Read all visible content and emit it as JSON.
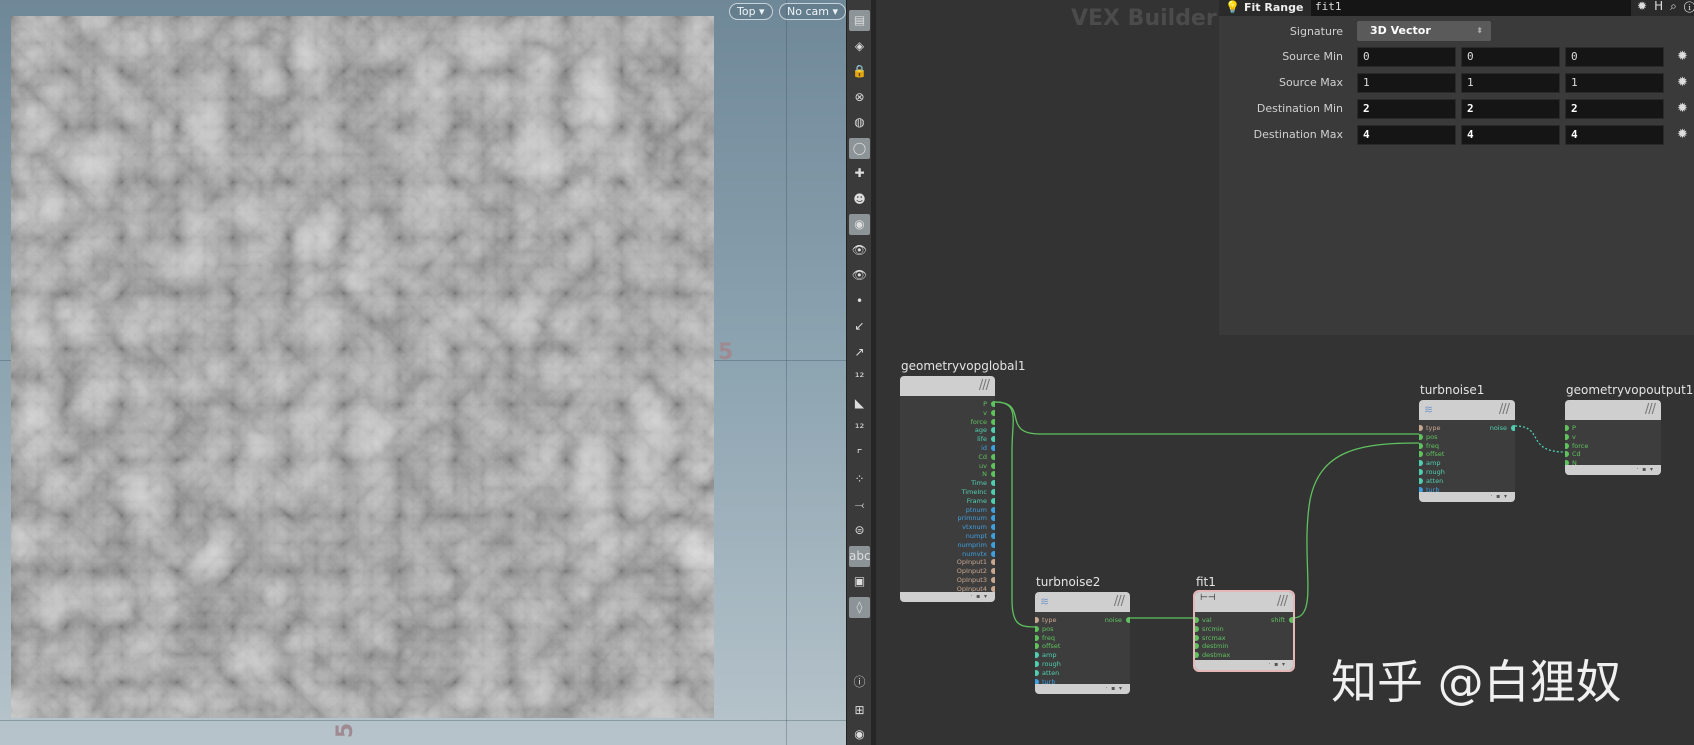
{
  "viewport": {
    "view_menu": "Top ▾",
    "camera_menu": "No cam ▾",
    "axis_labels": [
      "5",
      "5"
    ]
  },
  "toolbar": {
    "icons": [
      "display-options-icon",
      "snapping-icon",
      "lock-icon",
      "ghost-icon",
      "shading-icon",
      "light-icon",
      "add-light-icon",
      "headlight-icon",
      "render-icon",
      "visibility-icon",
      "camera-visibility-icon",
      "point-icon",
      "normal-icon",
      "point-normal-icon",
      "point-number-icon",
      "prim-normal-icon",
      "prim-number-icon",
      "uv-icon",
      "breakpoint-icon",
      "vector-icon",
      "bounding-icon",
      "abc",
      "background-image-icon",
      "pin-icon",
      "info-icon",
      "layout-grid-icon",
      "eye-icon"
    ]
  },
  "network": {
    "title": "VEX Builder",
    "watermark": "知乎 @白狸奴"
  },
  "params": {
    "node_type": "Fit Range",
    "node_name": "fit1",
    "header_icons": [
      "gear-icon",
      "hda-icon",
      "search-icon",
      "info-icon",
      "help-icon"
    ],
    "signature_label": "Signature",
    "signature_value": "3D Vector",
    "rows": [
      {
        "label": "Source Min",
        "values": [
          "0",
          "0",
          "0"
        ]
      },
      {
        "label": "Source Max",
        "values": [
          "1",
          "1",
          "1"
        ]
      },
      {
        "label": "Destination Min",
        "values": [
          "2",
          "2",
          "2"
        ]
      },
      {
        "label": "Destination Max",
        "values": [
          "4",
          "4",
          "4"
        ]
      }
    ]
  },
  "colors": {
    "vector": "#5fc25f",
    "float": "#4fcfb0",
    "int": "#3fa0e0",
    "string": "#c8a890"
  },
  "nodes": [
    {
      "name": "geometryvopglobal1",
      "inputs": [],
      "outputs": [
        [
          "P",
          "vector"
        ],
        [
          "v",
          "vector"
        ],
        [
          "force",
          "vector"
        ],
        [
          "age",
          "float"
        ],
        [
          "life",
          "float"
        ],
        [
          "id",
          "int"
        ],
        [
          "Cd",
          "vector"
        ],
        [
          "uv",
          "vector"
        ],
        [
          "N",
          "vector"
        ],
        [
          "Time",
          "float"
        ],
        [
          "TimeInc",
          "float"
        ],
        [
          "Frame",
          "float"
        ],
        [
          "ptnum",
          "int"
        ],
        [
          "primnum",
          "int"
        ],
        [
          "vtxnum",
          "int"
        ],
        [
          "numpt",
          "int"
        ],
        [
          "numprim",
          "int"
        ],
        [
          "numvtx",
          "int"
        ],
        [
          "OpInput1",
          "string"
        ],
        [
          "OpInput2",
          "string"
        ],
        [
          "OpInput3",
          "string"
        ],
        [
          "OpInput4",
          "string"
        ]
      ]
    },
    {
      "name": "turbnoise2",
      "inputs": [
        [
          "type",
          "string"
        ],
        [
          "pos",
          "vector"
        ],
        [
          "freq",
          "vector"
        ],
        [
          "offset",
          "vector"
        ],
        [
          "amp",
          "float"
        ],
        [
          "rough",
          "float"
        ],
        [
          "atten",
          "float"
        ],
        [
          "turb",
          "int"
        ]
      ],
      "outputs": [
        [
          "noise",
          "vector"
        ]
      ]
    },
    {
      "name": "fit1",
      "inputs": [
        [
          "val",
          "vector"
        ],
        [
          "srcmin",
          "vector"
        ],
        [
          "srcmax",
          "vector"
        ],
        [
          "destmin",
          "vector"
        ],
        [
          "destmax",
          "vector"
        ]
      ],
      "outputs": [
        [
          "shift",
          "vector"
        ]
      ]
    },
    {
      "name": "turbnoise1",
      "inputs": [
        [
          "type",
          "string"
        ],
        [
          "pos",
          "vector"
        ],
        [
          "freq",
          "vector"
        ],
        [
          "offset",
          "vector"
        ],
        [
          "amp",
          "float"
        ],
        [
          "rough",
          "float"
        ],
        [
          "atten",
          "float"
        ],
        [
          "turb",
          "int"
        ]
      ],
      "outputs": [
        [
          "noise",
          "float"
        ]
      ]
    },
    {
      "name": "geometryvopoutput1",
      "inputs": [
        [
          "P",
          "vector"
        ],
        [
          "v",
          "vector"
        ],
        [
          "force",
          "vector"
        ],
        [
          "Cd",
          "vector"
        ],
        [
          "N",
          "vector"
        ]
      ],
      "outputs": []
    }
  ]
}
